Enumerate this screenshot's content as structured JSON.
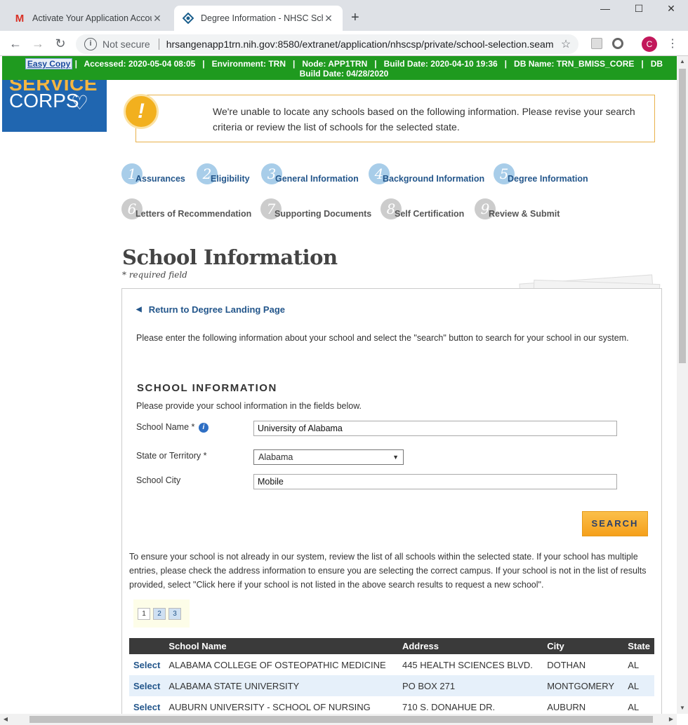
{
  "browser": {
    "tabs": [
      {
        "title": "Activate Your Application Accou",
        "icon": "gmail-icon"
      },
      {
        "title": "Degree Information - NHSC Scho",
        "icon": "nhsc-icon"
      }
    ],
    "new_tab": "+",
    "window_controls": {
      "minimize": "—",
      "maximize": "☐",
      "close": "✕"
    },
    "security_label": "Not secure",
    "url": "hrsangenapp1trn.nih.gov:8580/extranet/application/nhscsp/private/school-selection.seam",
    "avatar_letter": "C"
  },
  "env_bar": {
    "easy_copy": "Easy Copy",
    "line1": "|   Accessed: 2020-05-04 08:05   |   Environment: TRN   |   Node: APP1TRN   |   Build Date: 2020-04-10 19:36   |   DB Name: TRN_BMISS_CORE   |   DB",
    "line2": "Build Date: 04/28/2020"
  },
  "logo": {
    "line1": "SERVICE",
    "line2": "CORPS"
  },
  "alert": {
    "icon": "!",
    "message": "We're unable to locate any schools based on the following information. Please revise your search criteria or review the list of schools for the selected state."
  },
  "steps": [
    {
      "num": "1",
      "label": "Assurances",
      "status": "done"
    },
    {
      "num": "2",
      "label": "Eligibility",
      "status": "done"
    },
    {
      "num": "3",
      "label": "General Information",
      "status": "done"
    },
    {
      "num": "4",
      "label": "Background Information",
      "status": "done"
    },
    {
      "num": "5",
      "label": "Degree Information",
      "status": "done"
    },
    {
      "num": "6",
      "label": "Letters of Recommendation",
      "status": "todo"
    },
    {
      "num": "7",
      "label": "Supporting Documents",
      "status": "todo"
    },
    {
      "num": "8",
      "label": "Self Certification",
      "status": "todo"
    },
    {
      "num": "9",
      "label": "Review & Submit",
      "status": "todo"
    }
  ],
  "page": {
    "title": "School Information",
    "required_note": "* required field",
    "back_link": "Return to Degree Landing Page",
    "intro": "Please enter the following information about your school and select the \"search\" button to search for your school in our system.",
    "section_heading": "SCHOOL INFORMATION",
    "section_sub": "Please provide your school information in the fields below."
  },
  "form": {
    "school_name_label": "School Name *",
    "school_name_value": "University of Alabama",
    "state_label": "State or Territory *",
    "state_value": "Alabama",
    "city_label": "School City",
    "city_value": "Mobile",
    "search_button": "SEARCH"
  },
  "results": {
    "intro": "To ensure your school is not already in our system, review the list of all schools within the selected state. If your school has multiple entries, please check the address information to ensure you are selecting the correct campus. If your school is not in the list of results provided, select \"Click here if your school is not listed in the above search results to request a new school\".",
    "pages": [
      "1",
      "2",
      "3"
    ],
    "columns": [
      "",
      "School Name",
      "Address",
      "City",
      "State"
    ],
    "rows": [
      {
        "action": "Select",
        "name": "ALABAMA COLLEGE OF OSTEOPATHIC MEDICINE",
        "address": "445 HEALTH SCIENCES BLVD.",
        "city": "DOTHAN",
        "state": "AL"
      },
      {
        "action": "Select",
        "name": "ALABAMA STATE UNIVERSITY",
        "address": "PO BOX 271",
        "city": "MONTGOMERY",
        "state": "AL"
      },
      {
        "action": "Select",
        "name": "AUBURN UNIVERSITY - SCHOOL OF NURSING",
        "address": "710 S. DONAHUE DR.",
        "city": "AUBURN",
        "state": "AL"
      }
    ]
  }
}
